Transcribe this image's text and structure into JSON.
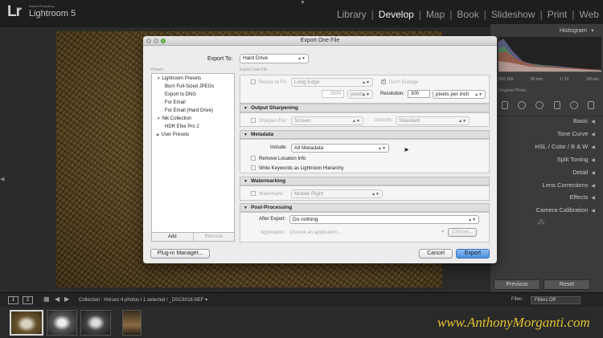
{
  "app": {
    "logo_mark": "Lr",
    "logo_sub": "Adobe Photoshop",
    "logo_name": "Lightroom 5",
    "modules": [
      "Library",
      "Develop",
      "Map",
      "Book",
      "Slideshow",
      "Print",
      "Web"
    ],
    "active_module": "Develop",
    "separator": "|"
  },
  "right_panel": {
    "histogram_label": "Histogram",
    "histogram_readout": [
      "ISO 100",
      "90 mm",
      "f / 11",
      "1/8 sec"
    ],
    "original_photo": "Original Photo",
    "sections": [
      "Basic",
      "Tone Curve",
      "HSL / Color / B & W",
      "Split Toning",
      "Detail",
      "Lens Corrections",
      "Effects",
      "Camera Calibration"
    ],
    "previous_button": "Previous",
    "reset_button": "Reset"
  },
  "filmstrip": {
    "view_1": "1",
    "view_2": "2",
    "info": "Collection : Horses    4 photos / 1 selected / _DSC6018.NEF ▾",
    "filter_label": "Filter :",
    "filter_value": "Filters Off"
  },
  "watermark": "www.AnthonyMorganti.com",
  "dialog": {
    "title": "Export One File",
    "export_to_label": "Export To:",
    "export_to_value": "Hard Drive",
    "preset_label": "Preset:",
    "panel_label": "Export One File",
    "presets": {
      "group_lightroom": "Lightroom Presets",
      "items_lightroom": [
        "Burn Full-Sized JPEGs",
        "Export to DNG",
        "For Email",
        "For Email (Hard Drive)"
      ],
      "group_nik": "Nik Collection",
      "items_nik": [
        "HDR Efex Pro 2"
      ],
      "group_user": "User Presets"
    },
    "add_button": "Add",
    "remove_button": "Remove",
    "resize": {
      "label": "Resize to Fit:",
      "mode": "Long Edge",
      "dont_enlarge": "Don't Enlarge",
      "size": "2500",
      "unit": "pixels",
      "resolution_label": "Resolution:",
      "resolution": "300",
      "resolution_unit": "pixels per inch"
    },
    "sharpening": {
      "header": "Output Sharpening",
      "label": "Sharpen For:",
      "value": "Screen",
      "amount_label": "Amount:",
      "amount_value": "Standard"
    },
    "metadata": {
      "header": "Metadata",
      "include_label": "Include:",
      "include_value": "All Metadata",
      "remove_location": "Remove Location Info",
      "write_keywords": "Write Keywords as Lightroom Hierarchy"
    },
    "watermarking": {
      "header": "Watermarking",
      "label": "Watermark:",
      "value": "Mobile Right"
    },
    "post_processing": {
      "header": "Post-Processing",
      "after_export_label": "After Export:",
      "after_export_value": "Do nothing",
      "application_label": "Application:",
      "application_placeholder": "Choose an application...",
      "choose_button": "Choose..."
    },
    "plugin_manager_button": "Plug-in Manager...",
    "cancel_button": "Cancel",
    "export_button": "Export"
  },
  "colors": {
    "watermark": "#e3c22f",
    "export_button": "#4a8fe0",
    "active_module": "#f2f2f2"
  }
}
